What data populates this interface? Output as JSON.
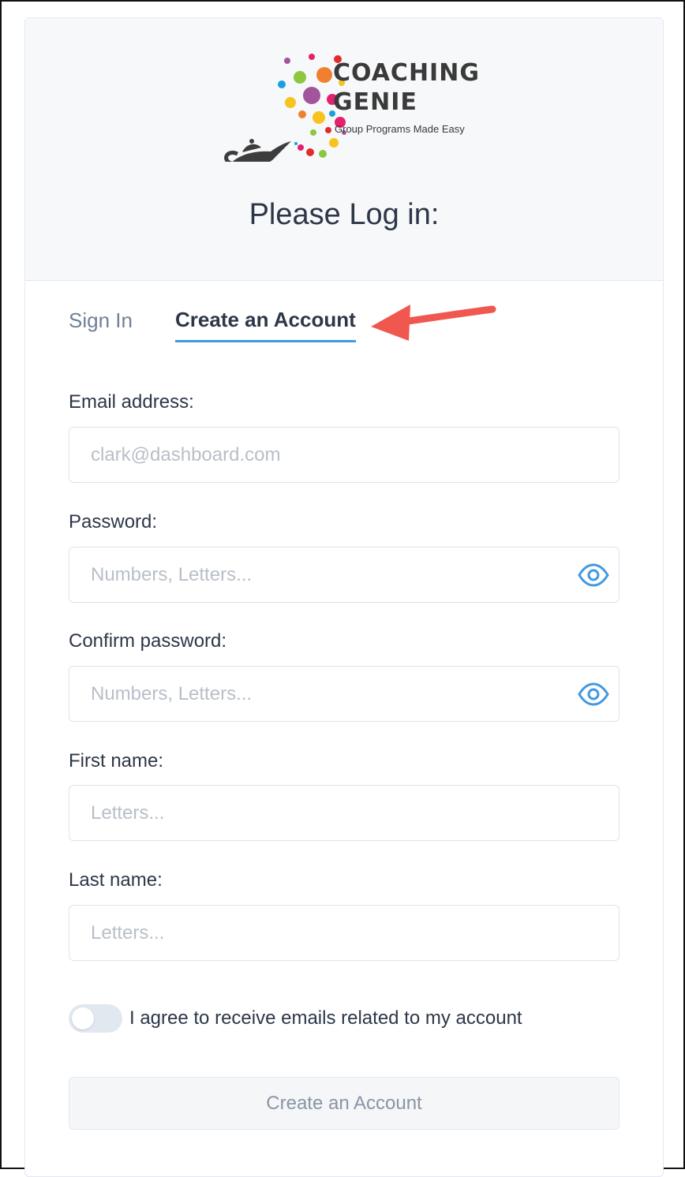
{
  "brand": {
    "name_line1": "COACHING",
    "name_line2": "GENIE",
    "tagline": "Group Programs Made Easy",
    "logo_icon": "genie-lamp-with-colored-dots"
  },
  "page_title": "Please Log in:",
  "tabs": [
    {
      "label": "Sign In",
      "active": false
    },
    {
      "label": "Create an Account",
      "active": true
    }
  ],
  "form": {
    "email": {
      "label": "Email address:",
      "placeholder": "clark@dashboard.com",
      "value": ""
    },
    "password": {
      "label": "Password:",
      "placeholder": "Numbers, Letters...",
      "value": "",
      "icon": "eye-icon"
    },
    "confirm_password": {
      "label": "Confirm password:",
      "placeholder": "Numbers, Letters...",
      "value": "",
      "icon": "eye-icon"
    },
    "first_name": {
      "label": "First name:",
      "placeholder": "Letters...",
      "value": ""
    },
    "last_name": {
      "label": "Last name:",
      "placeholder": "Letters...",
      "value": ""
    },
    "consent": {
      "label": "I agree to receive emails related to my account",
      "checked": false
    },
    "submit_label": "Create an Account"
  },
  "colors": {
    "accent": "#4299e1",
    "annotation_arrow": "#f0584f",
    "header_bg": "#f7f8fa"
  }
}
